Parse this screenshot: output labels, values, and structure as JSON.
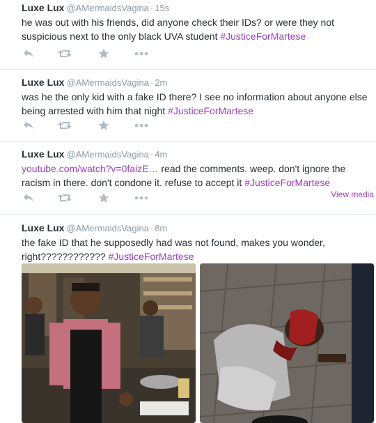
{
  "tweets": [
    {
      "name": "Luxe Lux",
      "handle": "@AMermaidsVagina",
      "dot": "·",
      "time": "15s",
      "text": "he was out with his friends, did anyone check their IDs? or were they not suspicious next to the only black UVA student ",
      "hashtag": "#JusticeForMartese"
    },
    {
      "name": "Luxe Lux",
      "handle": "@AMermaidsVagina",
      "dot": "·",
      "time": "2m",
      "text": "was he the only kid with a fake ID there? I see no information about anyone else being arrested with him that night ",
      "hashtag": "#JusticeForMartese"
    },
    {
      "name": "Luxe Lux",
      "handle": "@AMermaidsVagina",
      "dot": "·",
      "time": "4m",
      "link": "youtube.com/watch?v=0faizE…",
      "text": " read the comments. weep. don't ignore the racism in there. don't condone it. refuse to accept it ",
      "hashtag": "#JusticeForMartese",
      "view_media": "View media"
    },
    {
      "name": "Luxe Lux",
      "handle": "@AMermaidsVagina",
      "dot": "·",
      "time": "8m",
      "text": "the fake ID that he supposedly had was not found, makes you wonder, right???????????? ",
      "hashtag": "#JusticeForMartese"
    }
  ],
  "icons": {
    "reply": "reply-icon",
    "retweet": "retweet-icon",
    "favorite": "star-icon",
    "more": "more-icon"
  },
  "colors": {
    "hashtag": "#9b3fbe",
    "meta": "#8899a6",
    "action": "#b0bcc5",
    "divider": "#e1e8ed"
  }
}
